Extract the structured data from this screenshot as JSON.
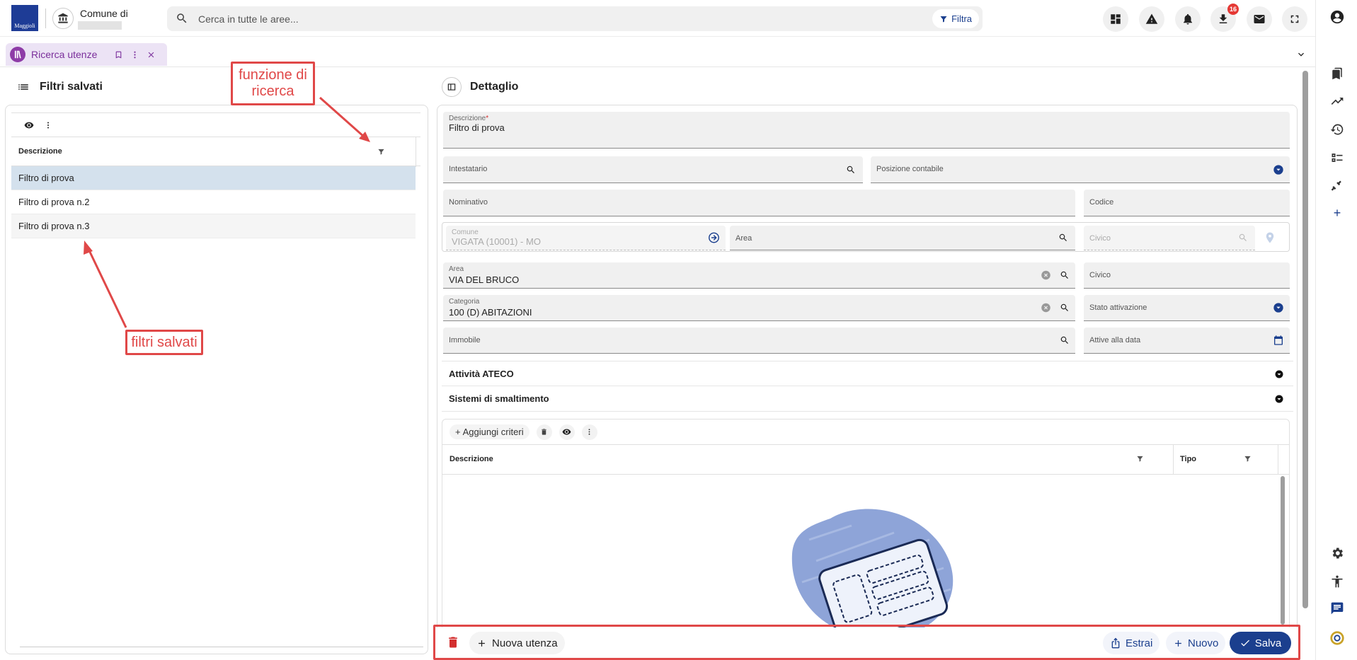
{
  "topbar": {
    "logo_text": "Maggioli",
    "comune_title": "Comune di",
    "search_placeholder": "Cerca in tutte le aree...",
    "filtra_label": "Filtra",
    "download_badge": "16"
  },
  "tab": {
    "label": "Ricerca utenze"
  },
  "left": {
    "title": "Filtri salvati",
    "column": "Descrizione",
    "rows": [
      "Filtro di prova",
      "Filtro di prova n.2",
      "Filtro di prova n.3"
    ]
  },
  "right": {
    "title": "Dettaglio",
    "descrizione_label": "Descrizione",
    "descrizione_value": "Filtro di prova",
    "intestatario": "Intestatario",
    "posizione": "Posizione contabile",
    "nominativo": "Nominativo",
    "codice": "Codice",
    "comune_label": "Comune",
    "comune_value": "VIGATA (10001) - MO",
    "area_label": "Area",
    "civico_label": "Civico",
    "area2_label": "Area",
    "area2_value": "VIA DEL BRUCO",
    "civico2_label": "Civico",
    "categoria_label": "Categoria",
    "categoria_value": "100 (D) ABITAZIONI",
    "stato_label": "Stato attivazione",
    "immobile_label": "Immobile",
    "attive_label": "Attive alla data",
    "acc_ateco": "Attività ATECO",
    "acc_smalt": "Sistemi di smaltimento",
    "add_criteri": "Aggiungi criteri",
    "col_desc": "Descrizione",
    "col_tipo": "Tipo"
  },
  "footer": {
    "nuova_utenza": "Nuova utenza",
    "estrai": "Estrai",
    "nuovo": "Nuovo",
    "salva": "Salva"
  },
  "annotations": {
    "funzione_line1": "funzione di",
    "funzione_line2": "ricerca",
    "filtri": "filtri salvati"
  },
  "colors": {
    "accent": "#1b3f8e",
    "tab": "#8e3ca7",
    "annotation": "#e04848",
    "selected_row": "#d4e1ed"
  }
}
